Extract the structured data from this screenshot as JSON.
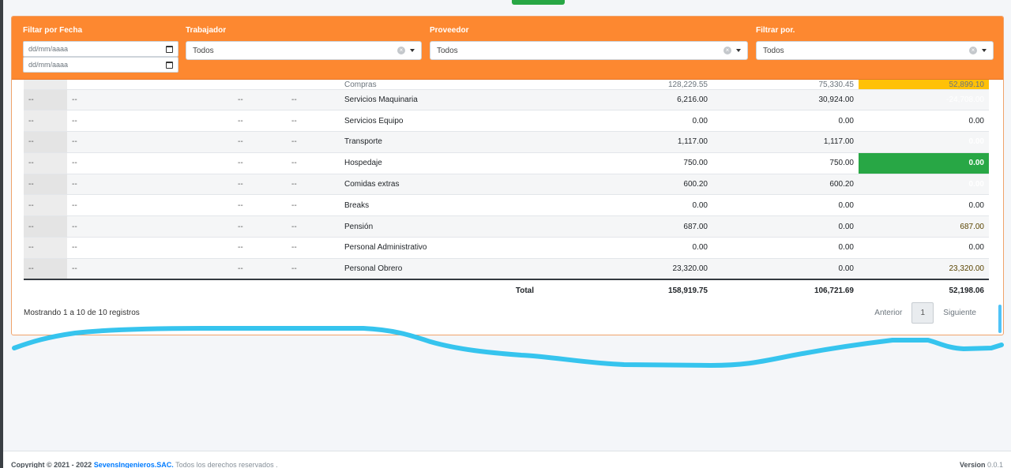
{
  "filters": {
    "fecha_label": "Filtar por Fecha",
    "date_from_placeholder": "dd/mm/aaaa",
    "date_to_placeholder": "dd/mm/aaaa",
    "trabajador_label": "Trabajador",
    "trabajador_value": "Todos",
    "proveedor_label": "Proveedor",
    "proveedor_value": "Todos",
    "filtrar_label": "Filtrar por.",
    "filtrar_value": "Todos"
  },
  "table": {
    "partial_row": {
      "concept": "Compras",
      "v1": "128,229.55",
      "v2": "75,330.45",
      "diff": "52,899.10"
    },
    "rows": [
      {
        "c1": "--",
        "c2": "--",
        "c3": "--",
        "c4": "--",
        "concept": "Servicios Maquinaria",
        "v1": "6,216.00",
        "v2": "30,924.00",
        "diff": "-24,708.00",
        "status": "red"
      },
      {
        "c1": "--",
        "c2": "--",
        "c3": "--",
        "c4": "--",
        "concept": "Servicios Equipo",
        "v1": "0.00",
        "v2": "0.00",
        "diff": "0.00",
        "status": "none"
      },
      {
        "c1": "--",
        "c2": "--",
        "c3": "--",
        "c4": "--",
        "concept": "Transporte",
        "v1": "1,117.00",
        "v2": "1,117.00",
        "diff": "0.00",
        "status": "green"
      },
      {
        "c1": "--",
        "c2": "--",
        "c3": "--",
        "c4": "--",
        "concept": "Hospedaje",
        "v1": "750.00",
        "v2": "750.00",
        "diff": "0.00",
        "status": "green"
      },
      {
        "c1": "--",
        "c2": "--",
        "c3": "--",
        "c4": "--",
        "concept": "Comidas extras",
        "v1": "600.20",
        "v2": "600.20",
        "diff": "0.00",
        "status": "green"
      },
      {
        "c1": "--",
        "c2": "--",
        "c3": "--",
        "c4": "--",
        "concept": "Breaks",
        "v1": "0.00",
        "v2": "0.00",
        "diff": "0.00",
        "status": "none"
      },
      {
        "c1": "--",
        "c2": "--",
        "c3": "--",
        "c4": "--",
        "concept": "Pensión",
        "v1": "687.00",
        "v2": "0.00",
        "diff": "687.00",
        "status": "yellow"
      },
      {
        "c1": "--",
        "c2": "--",
        "c3": "--",
        "c4": "--",
        "concept": "Personal Administrativo",
        "v1": "0.00",
        "v2": "0.00",
        "diff": "0.00",
        "status": "none"
      },
      {
        "c1": "--",
        "c2": "--",
        "c3": "--",
        "c4": "--",
        "concept": "Personal Obrero",
        "v1": "23,320.00",
        "v2": "0.00",
        "diff": "23,320.00",
        "status": "yellow"
      }
    ],
    "total": {
      "label": "Total",
      "v1": "158,919.75",
      "v2": "106,721.69",
      "diff": "52,198.06"
    },
    "status_colors": {
      "red": "#dc3545",
      "green": "#28a745",
      "yellow": "#ffc107"
    }
  },
  "pagination": {
    "info": "Mostrando 1 a 10 de 10 registros",
    "prev": "Anterior",
    "page": "1",
    "next": "Siguiente"
  },
  "footer": {
    "copyright": "Copyright © 2021 - 2022",
    "company": "SevensIngenieros.SAC.",
    "rights": "Todos los derechos reservados .",
    "version_label": "Version",
    "version_value": "0.0.1"
  },
  "annotation": {
    "color": "#36c4ee"
  }
}
